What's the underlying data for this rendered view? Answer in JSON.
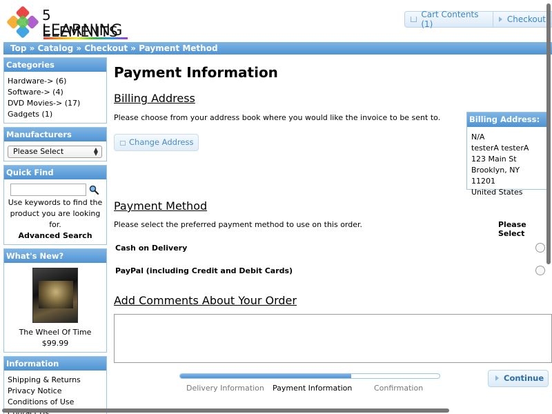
{
  "logo": {
    "line1": "5 ELEMENTS",
    "line2": "LEARNING"
  },
  "header": {
    "cart_label": "Cart Contents (1)",
    "checkout_label": "Checkout"
  },
  "breadcrumb": {
    "text": "Top » Catalog » Checkout » Payment Method"
  },
  "sidebar": {
    "categories": {
      "title": "Categories",
      "items": [
        {
          "label": "Hardware-> (6)"
        },
        {
          "label": "Software-> (4)"
        },
        {
          "label": "DVD Movies-> (17)"
        },
        {
          "label": "Gadgets (1)"
        }
      ]
    },
    "manufacturers": {
      "title": "Manufacturers",
      "selected": "Please Select"
    },
    "quick_find": {
      "title": "Quick Find",
      "input_value": "",
      "help_text": "Use keywords to find the product you are looking for.",
      "advanced_label": "Advanced Search"
    },
    "whats_new": {
      "title": "What's New?",
      "product_name": "The Wheel Of Time",
      "price": "$99.99"
    },
    "information": {
      "title": "Information",
      "items": [
        {
          "label": "Shipping & Returns"
        },
        {
          "label": "Privacy Notice"
        },
        {
          "label": "Conditions of Use"
        },
        {
          "label": "Contact Us"
        }
      ]
    }
  },
  "main": {
    "title": "Payment Information",
    "billing": {
      "heading": "Billing Address",
      "instructions": "Please choose from your address book where you would like the invoice to be sent to.",
      "change_button": "Change Address",
      "box_title": "Billing Address:",
      "address_lines": [
        "N/A",
        "testerA testerA",
        "123 Main St",
        "Brooklyn, NY 11201",
        "United States"
      ]
    },
    "payment": {
      "heading": "Payment Method",
      "instructions": "Please select the preferred payment method to use on this order.",
      "please_select": "Please Select",
      "options": [
        {
          "label": "Cash on Delivery",
          "selected": false
        },
        {
          "label": "PayPal (including Credit and Debit Cards)",
          "selected": false
        }
      ]
    },
    "comments": {
      "heading": "Add Comments About Your Order",
      "value": ""
    },
    "progress": {
      "fraction": 0.66,
      "steps": [
        {
          "label": "Delivery Information",
          "active": false
        },
        {
          "label": "Payment Information",
          "active": true
        },
        {
          "label": "Confirmation",
          "active": false
        }
      ]
    },
    "continue_label": "Continue"
  },
  "colors": {
    "accent": "#4f93d3",
    "link": "#3a86c8",
    "box_border": "#9cc4e6"
  },
  "icons": {
    "cart": "cart-icon",
    "arrow": "arrow-right-icon",
    "search": "magnifier-icon",
    "home": "home-icon"
  }
}
